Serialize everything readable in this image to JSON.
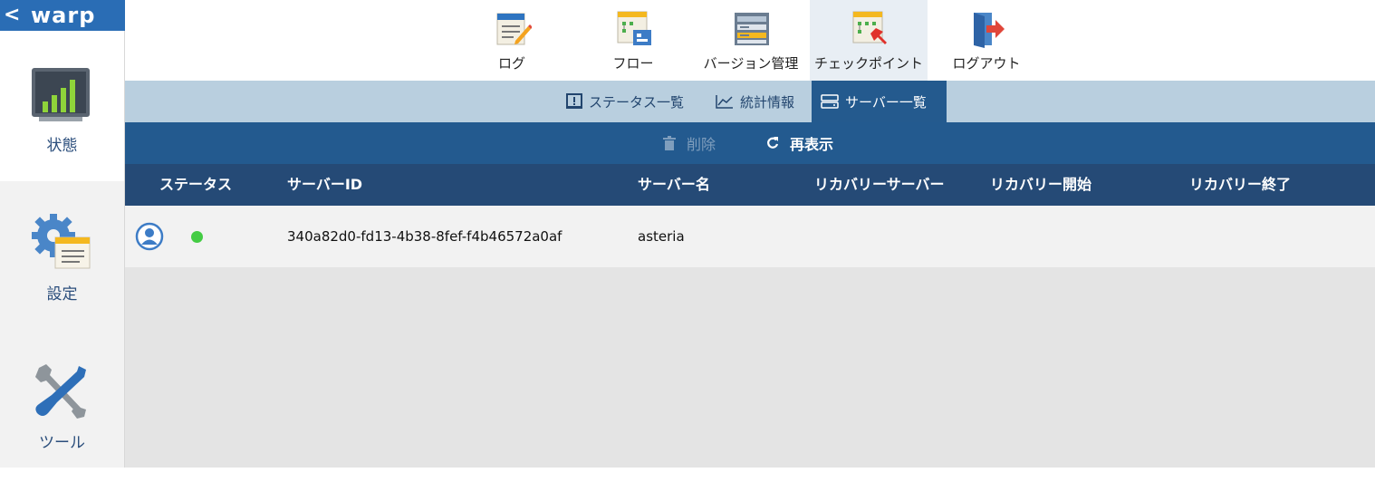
{
  "app": {
    "logo_text": "warp",
    "back_glyph": "<"
  },
  "sidebar": {
    "items": [
      {
        "label": "状態",
        "icon": "bar-chart-icon",
        "active": true
      },
      {
        "label": "設定",
        "icon": "gear-settings-icon",
        "active": false
      },
      {
        "label": "ツール",
        "icon": "tools-icon",
        "active": false
      }
    ]
  },
  "toolbar": {
    "items": [
      {
        "label": "ログ",
        "icon": "log-notepad-icon"
      },
      {
        "label": "フロー",
        "icon": "flow-icon"
      },
      {
        "label": "バージョン管理",
        "icon": "version-control-icon"
      },
      {
        "label": "チェックポイント",
        "icon": "checkpoint-pin-icon",
        "active": true
      },
      {
        "label": "ログアウト",
        "icon": "logout-door-icon"
      }
    ]
  },
  "subtabs": [
    {
      "label": "ステータス一覧",
      "icon": "exclamation-box-icon"
    },
    {
      "label": "統計情報",
      "icon": "line-chart-icon"
    },
    {
      "label": "サーバー一覧",
      "icon": "server-icon",
      "active": true
    }
  ],
  "actions": {
    "delete_label": "削除",
    "refresh_label": "再表示"
  },
  "table": {
    "headers": [
      "ステータス",
      "サーバーID",
      "サーバー名",
      "リカバリーサーバー",
      "リカバリー開始",
      "リカバリー終了"
    ],
    "rows": [
      {
        "status_icon": "user-icon",
        "status_color": "#44cc44",
        "server_id": "340a82d0-fd13-4b38-8fef-f4b46572a0af",
        "server_name": "asteria",
        "recovery_server": "",
        "recovery_start": "",
        "recovery_end": ""
      }
    ]
  },
  "colors": {
    "brand_blue": "#2a6db5",
    "header_dark": "#254a76",
    "action_bar": "#235a8f",
    "subtab_bg": "#b9cfdf",
    "online_green": "#44cc44"
  }
}
